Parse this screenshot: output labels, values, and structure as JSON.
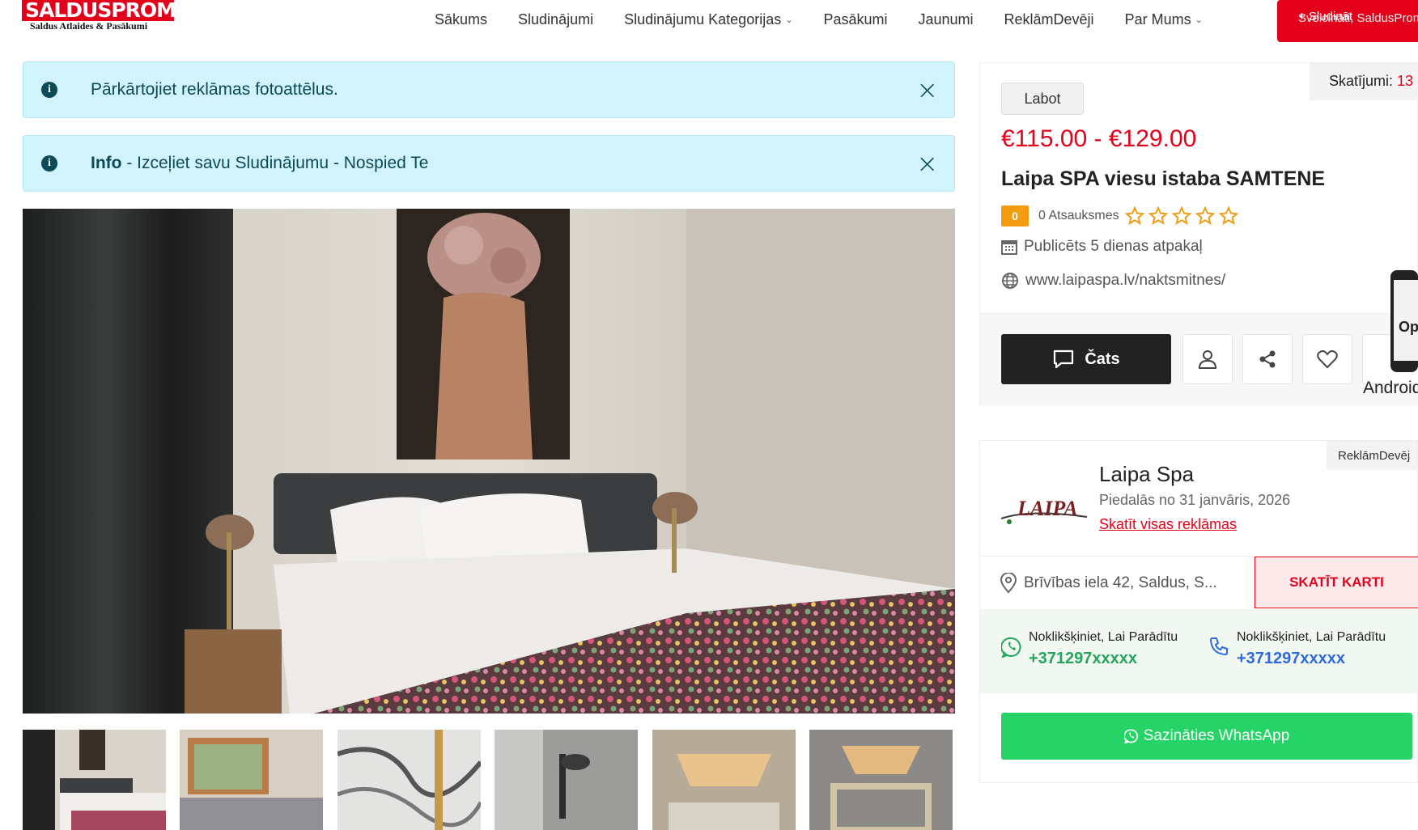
{
  "logo": {
    "brand": "SALDUSPROMO",
    "tagline": "Saldus Atlaides & Pasākumi"
  },
  "nav": {
    "items": [
      {
        "label": "Sākums",
        "dropdown": false
      },
      {
        "label": "Sludinājumi",
        "dropdown": false
      },
      {
        "label": "Sludinājumu Kategorijas",
        "dropdown": true
      },
      {
        "label": "Pasākumi",
        "dropdown": false
      },
      {
        "label": "Jaunumi",
        "dropdown": false
      },
      {
        "label": "ReklāmDevēji",
        "dropdown": false
      },
      {
        "label": "Par Mums",
        "dropdown": true
      }
    ],
    "cta_label": "+ Sludināt",
    "cta_overlay": "Sveicināti, SaldusPromo"
  },
  "alerts": [
    {
      "text": "Pārkārtojiet reklāmas fotoattēlus."
    },
    {
      "bold": "Info",
      "text": " - Izceļiet savu Sludinājumu - Nospied Te"
    }
  ],
  "listing": {
    "edit_label": "Labot",
    "views_label": "Skatījumi:",
    "views_count": "13",
    "price": "€115.00 - €129.00",
    "title": "Laipa SPA viesu istaba SAMTENE",
    "rating_value": "0",
    "reviews_label": "0 Atsauksmes",
    "stars_filled": 0,
    "stars_total": 5,
    "published": "Publicēts 5 dienas atpakaļ",
    "website": "www.laipaspa.lv/naktsmitnes/",
    "chat_label": "Čats"
  },
  "android_label": "Android",
  "seller": {
    "tag": "ReklāmDevēj",
    "logo_text": "LAIPA",
    "name": "Laipa Spa",
    "joined": "Piedalās no 31 janvāris, 2026",
    "all_ads_link": "Skatīt visas reklāmas",
    "address": "Brīvības iela 42, Saldus, S...",
    "map_button": "SKATĪT KARTI",
    "whatsapp_hint": "Noklikšķiniet, Lai Parādītu",
    "whatsapp_number": "+371297xxxxx",
    "phone_hint": "Noklikšķiniet, Lai Parādītu",
    "phone_number": "+371297xxxxx",
    "whatsapp_button": "Sazināties WhatsApp"
  },
  "colors": {
    "brand_red": "#e3001b",
    "alert_bg": "#d1f3fb",
    "whatsapp_green": "#25d366",
    "phone_blue": "#2f6bd8",
    "rating_orange": "#f39c12"
  },
  "icons": [
    "info-icon",
    "close-icon",
    "calendar-icon",
    "globe-icon",
    "chat-icon",
    "user-icon",
    "share-icon",
    "heart-icon",
    "map-pin-icon",
    "whatsapp-icon",
    "phone-icon",
    "star-icon",
    "chevron-down-icon"
  ]
}
